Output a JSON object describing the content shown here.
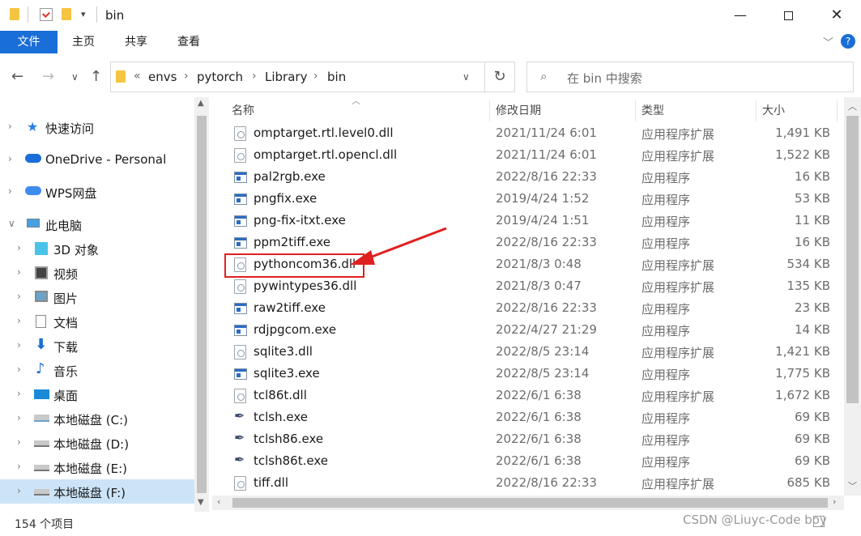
{
  "window": {
    "title": "bin",
    "minimize_icon": "minimize-icon",
    "maximize_icon": "maximize-icon",
    "close_icon": "close-icon"
  },
  "ribbon": {
    "tabs": [
      {
        "label": "文件"
      },
      {
        "label": "主页"
      },
      {
        "label": "共享"
      },
      {
        "label": "查看"
      }
    ]
  },
  "address": {
    "overflow": "«",
    "crumbs": [
      "envs",
      "pytorch",
      "Library",
      "bin"
    ]
  },
  "search": {
    "placeholder": "在 bin 中搜索"
  },
  "nav": {
    "items": [
      {
        "label": "快速访问",
        "icon": "star-icon"
      },
      {
        "label": "OneDrive - Personal",
        "icon": "cloud-icon"
      },
      {
        "label": "WPS网盘",
        "icon": "cloud-icon"
      },
      {
        "label": "此电脑",
        "icon": "computer-icon"
      },
      {
        "label": "3D 对象",
        "icon": "cube-icon"
      },
      {
        "label": "视频",
        "icon": "film-icon"
      },
      {
        "label": "图片",
        "icon": "picture-icon"
      },
      {
        "label": "文档",
        "icon": "document-icon"
      },
      {
        "label": "下载",
        "icon": "download-icon"
      },
      {
        "label": "音乐",
        "icon": "music-icon"
      },
      {
        "label": "桌面",
        "icon": "desktop-icon"
      },
      {
        "label": "本地磁盘 (C:)",
        "icon": "drive-icon"
      },
      {
        "label": "本地磁盘 (D:)",
        "icon": "drive-icon"
      },
      {
        "label": "本地磁盘 (E:)",
        "icon": "drive-icon"
      },
      {
        "label": "本地磁盘 (F:)",
        "icon": "drive-icon"
      }
    ]
  },
  "columns": {
    "name": "名称",
    "date": "修改日期",
    "type": "类型",
    "size": "大小"
  },
  "files": [
    {
      "name": "omptarget.rtl.level0.dll",
      "date": "2021/11/24 6:01",
      "type": "应用程序扩展",
      "size": "1,491 KB",
      "kind": "dll"
    },
    {
      "name": "omptarget.rtl.opencl.dll",
      "date": "2021/11/24 6:01",
      "type": "应用程序扩展",
      "size": "1,522 KB",
      "kind": "dll"
    },
    {
      "name": "pal2rgb.exe",
      "date": "2022/8/16 22:33",
      "type": "应用程序",
      "size": "16 KB",
      "kind": "exe"
    },
    {
      "name": "pngfix.exe",
      "date": "2019/4/24 1:52",
      "type": "应用程序",
      "size": "53 KB",
      "kind": "exe"
    },
    {
      "name": "png-fix-itxt.exe",
      "date": "2019/4/24 1:51",
      "type": "应用程序",
      "size": "11 KB",
      "kind": "exe"
    },
    {
      "name": "ppm2tiff.exe",
      "date": "2022/8/16 22:33",
      "type": "应用程序",
      "size": "16 KB",
      "kind": "exe"
    },
    {
      "name": "pythoncom36.dll",
      "date": "2021/8/3 0:48",
      "type": "应用程序扩展",
      "size": "534 KB",
      "kind": "dll"
    },
    {
      "name": "pywintypes36.dll",
      "date": "2021/8/3 0:47",
      "type": "应用程序扩展",
      "size": "135 KB",
      "kind": "dll"
    },
    {
      "name": "raw2tiff.exe",
      "date": "2022/8/16 22:33",
      "type": "应用程序",
      "size": "23 KB",
      "kind": "exe"
    },
    {
      "name": "rdjpgcom.exe",
      "date": "2022/4/27 21:29",
      "type": "应用程序",
      "size": "14 KB",
      "kind": "exe"
    },
    {
      "name": "sqlite3.dll",
      "date": "2022/8/5 23:14",
      "type": "应用程序扩展",
      "size": "1,421 KB",
      "kind": "dll"
    },
    {
      "name": "sqlite3.exe",
      "date": "2022/8/5 23:14",
      "type": "应用程序",
      "size": "1,775 KB",
      "kind": "exe"
    },
    {
      "name": "tcl86t.dll",
      "date": "2022/6/1 6:38",
      "type": "应用程序扩展",
      "size": "1,672 KB",
      "kind": "dll"
    },
    {
      "name": "tclsh.exe",
      "date": "2022/6/1 6:38",
      "type": "应用程序",
      "size": "69 KB",
      "kind": "feather"
    },
    {
      "name": "tclsh86.exe",
      "date": "2022/6/1 6:38",
      "type": "应用程序",
      "size": "69 KB",
      "kind": "feather"
    },
    {
      "name": "tclsh86t.exe",
      "date": "2022/6/1 6:38",
      "type": "应用程序",
      "size": "69 KB",
      "kind": "feather"
    },
    {
      "name": "tiff.dll",
      "date": "2022/8/16 22:33",
      "type": "应用程序扩展",
      "size": "685 KB",
      "kind": "dll"
    }
  ],
  "status": {
    "count": "154 个项目"
  },
  "watermark": "CSDN @Liuyc-Code boy",
  "colors": {
    "accent": "#1a6ed8",
    "selected": "#cce4f7",
    "annotation": "#e02020"
  }
}
